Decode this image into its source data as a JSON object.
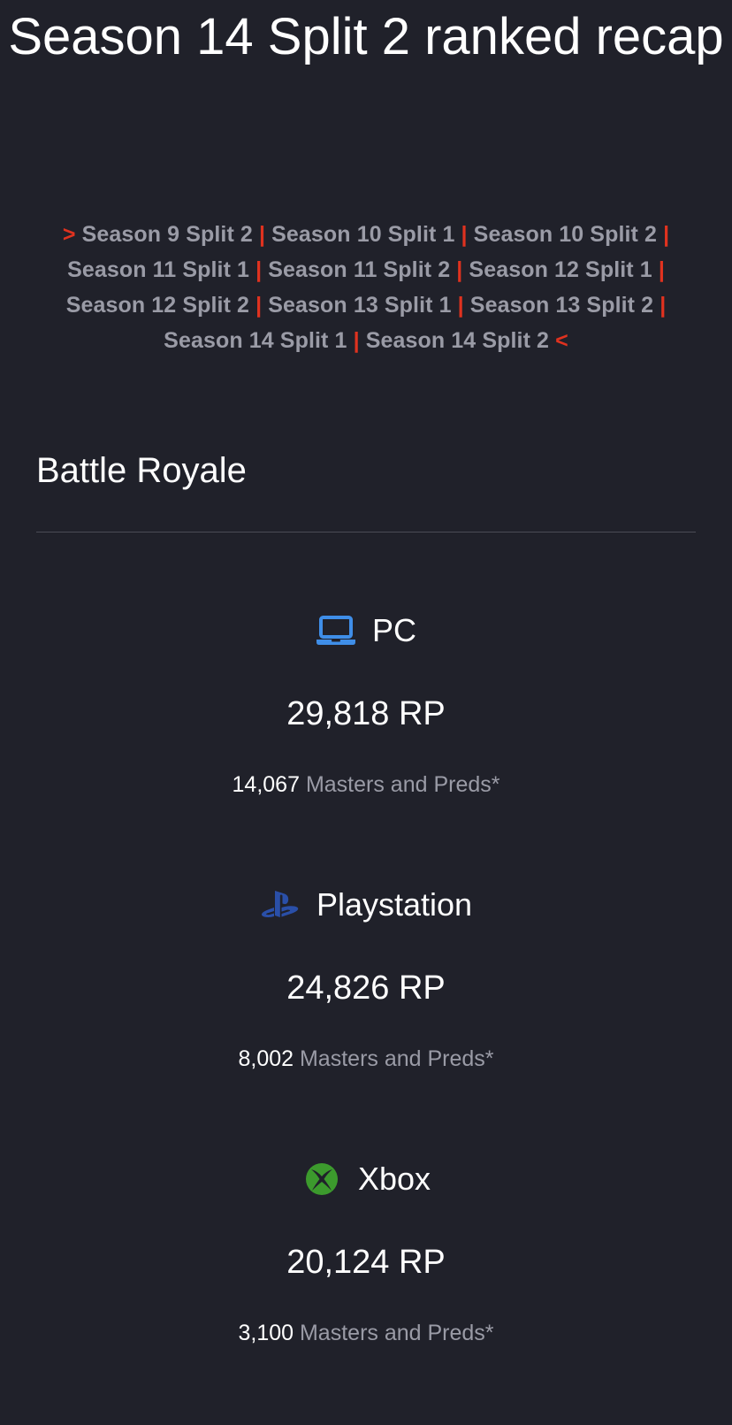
{
  "page": {
    "title": "Season 14 Split 2 ranked recap"
  },
  "nav": {
    "open_marker": ">",
    "close_marker": "<",
    "separator": "|",
    "links": [
      "Season 9 Split 2",
      "Season 10 Split 1",
      "Season 10 Split 2",
      "Season 11 Split 1",
      "Season 11 Split 2",
      "Season 12 Split 1",
      "Season 12 Split 2",
      "Season 13 Split 1",
      "Season 13 Split 2",
      "Season 14 Split 1",
      "Season 14 Split 2"
    ]
  },
  "section": {
    "heading": "Battle Royale"
  },
  "platforms": [
    {
      "name": "PC",
      "icon": "laptop-icon",
      "icon_color": "#3f8ee8",
      "rp": "29,818 RP",
      "masters_count": "14,067",
      "masters_label": "Masters and Preds*"
    },
    {
      "name": "Playstation",
      "icon": "playstation-icon",
      "icon_color": "#2a4fa8",
      "rp": "24,826 RP",
      "masters_count": "8,002",
      "masters_label": "Masters and Preds*"
    },
    {
      "name": "Xbox",
      "icon": "xbox-icon",
      "icon_color": "#3c9a2d",
      "rp": "20,124 RP",
      "masters_count": "3,100",
      "masters_label": "Masters and Preds*"
    }
  ],
  "colors": {
    "background": "#20212a",
    "accent": "#e0321f",
    "muted_text": "#9a9ba6",
    "text": "#ffffff"
  }
}
